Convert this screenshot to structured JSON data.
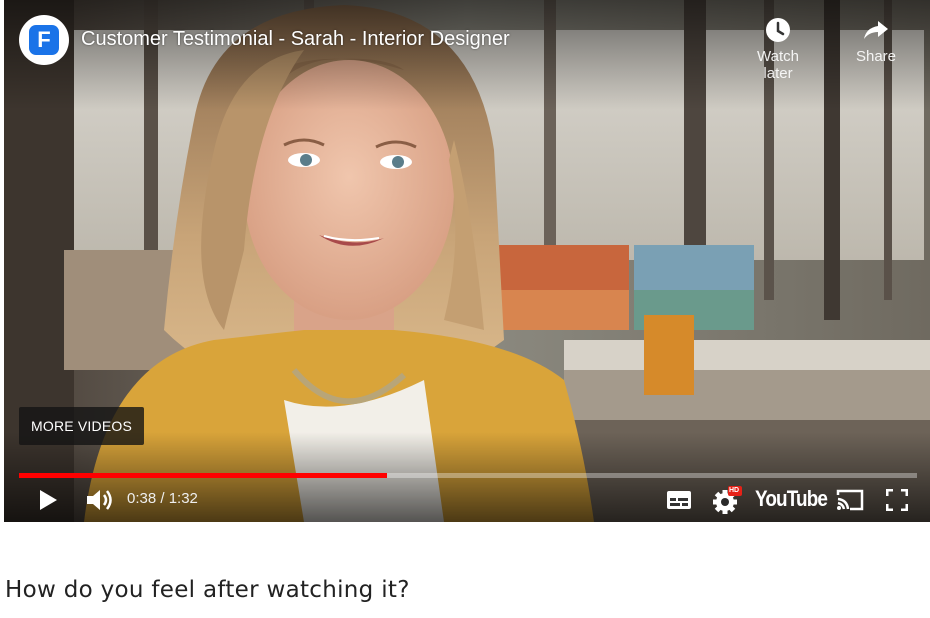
{
  "player": {
    "title": "Customer Testimonial - Sarah - Interior Designer",
    "channel_logo_letter": "F",
    "watch_later_label": "Watch later",
    "share_label": "Share",
    "more_videos_label": "MORE VIDEOS",
    "time_display": "0:38 / 1:32",
    "progress_fraction": 0.41,
    "youtube_logo_text": "YouTube",
    "quality_badge": "HD",
    "icons": [
      "play-icon",
      "volume-icon",
      "subtitles-icon",
      "settings-icon",
      "cast-icon",
      "fullscreen-icon",
      "clock-icon",
      "share-icon"
    ],
    "colors": {
      "progress": "#ff0000",
      "logo_blue": "#1a73e8",
      "cardigan": "#d9a43a"
    }
  },
  "page": {
    "question": "How do you feel after watching it?"
  }
}
